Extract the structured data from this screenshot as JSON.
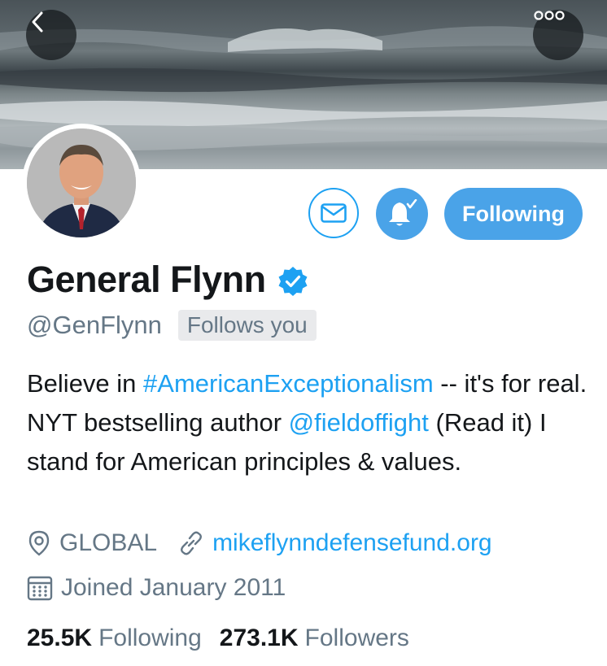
{
  "header": {
    "back_icon": "chevron-left-icon",
    "more_icon": "more-dots-icon"
  },
  "profile": {
    "name": "General Flynn",
    "verified": true,
    "handle": "@GenFlynn",
    "follows_you": "Follows you",
    "bio": {
      "part1": "Believe in ",
      "hashtag": "#AmericanExceptionalism",
      "part2": " -- it's for real. NYT bestselling author ",
      "mention": "@fieldoffight",
      "part3": " (Read it) I stand for American principles & values."
    },
    "location": "GLOBAL",
    "website": "mikeflynndefensefund.org",
    "joined": "Joined January 2011"
  },
  "actions": {
    "dm_icon": "envelope-icon",
    "notify_icon": "bell-check-icon",
    "following_label": "Following"
  },
  "stats": {
    "following_count": "25.5K",
    "following_label": "Following",
    "followers_count": "273.1K",
    "followers_label": "Followers"
  },
  "colors": {
    "accent": "#1da1f2",
    "button_fill": "#4aa3e8",
    "secondary_text": "#657786",
    "primary_text": "#14171a"
  }
}
